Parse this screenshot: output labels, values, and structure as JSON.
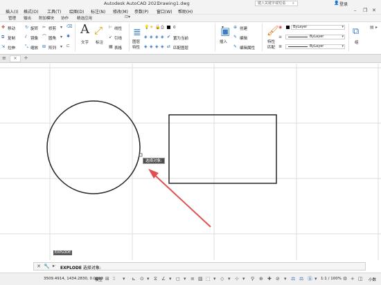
{
  "titlebar": {
    "app_title": "Autodesk AutoCAD 2021",
    "doc_title": "Drawing1.dwg",
    "search_placeholder": "键入关键字或短语",
    "login": "登录"
  },
  "menu": {
    "items": [
      "插入(I)",
      "格式(O)",
      "工具(T)",
      "绘图(D)",
      "标注(N)",
      "修改(M)",
      "参数(P)",
      "窗口(W)",
      "帮助(H)"
    ]
  },
  "ribbon_tabs": [
    "管理",
    "输出",
    "附加模块",
    "协作",
    "精选应用"
  ],
  "ribbon": {
    "modify": {
      "move": "移动",
      "rotate": "旋转",
      "trim": "修剪",
      "copy": "复制",
      "mirror": "镜像",
      "fillet": "圆角",
      "stretch": "拉伸",
      "scale": "缩放",
      "array": "阵列"
    },
    "annotation": {
      "text": "文字",
      "dimension": "标注",
      "linear": "线性",
      "leader": "引线",
      "table": "表格"
    },
    "layers": {
      "layer_properties": "图层",
      "layer_properties2": "特性",
      "layer_value": "0",
      "set_current": "置为当前",
      "match_layer": "匹配图层"
    },
    "block": {
      "insert": "插入",
      "create": "创建",
      "edit": "编辑",
      "edit_attributes": "编辑属性"
    },
    "properties": {
      "match": "特性",
      "match2": "匹配",
      "color": "ByLayer",
      "linetype": "ByLayer",
      "lineweight": "ByLayer"
    },
    "groups": {
      "group": "组"
    }
  },
  "canvas": {
    "tooltip": "选择对象:",
    "command_name": "EXPLODE"
  },
  "command_line": {
    "command": "EXPLODE",
    "prompt": "选择对象:"
  },
  "status": {
    "coords": "3509.4914, 1434.2830, 0.0000",
    "model": "模型",
    "scale": "1:1 / 100%",
    "small": "小数"
  },
  "colors": {
    "annotation_arrow": "#e05050",
    "tooltip_bg": "#4e4e4e",
    "grid": "#dedede"
  }
}
